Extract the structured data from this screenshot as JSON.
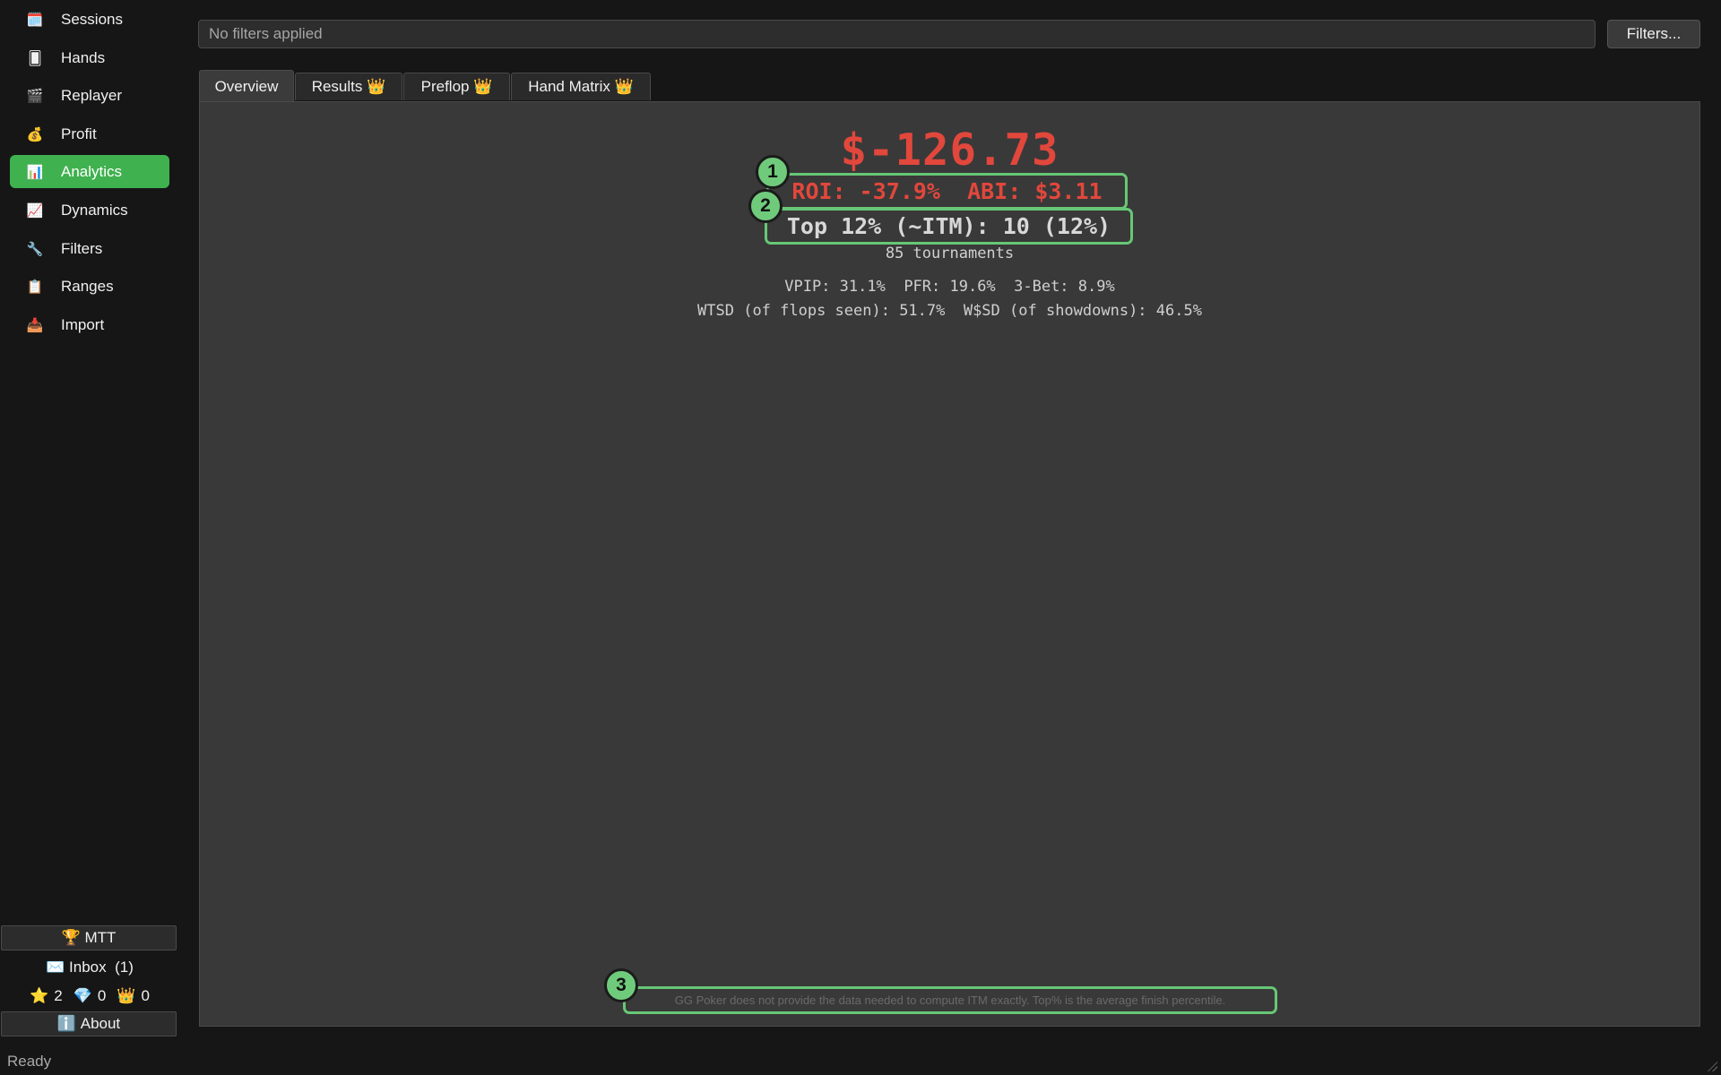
{
  "sidebar": {
    "items": [
      {
        "icon": "calendar-icon",
        "glyph": "🗓️",
        "label": "Sessions",
        "active": false
      },
      {
        "icon": "playing-card-icon",
        "glyph": "🂠",
        "label": "Hands",
        "active": false
      },
      {
        "icon": "clapperboard-icon",
        "glyph": "🎬",
        "label": "Replayer",
        "active": false
      },
      {
        "icon": "money-bag-icon",
        "glyph": "💰",
        "label": "Profit",
        "active": false
      },
      {
        "icon": "bar-chart-icon",
        "glyph": "📊",
        "label": "Analytics",
        "active": true
      },
      {
        "icon": "line-chart-icon",
        "glyph": "📈",
        "label": "Dynamics",
        "active": false
      },
      {
        "icon": "wrench-icon",
        "glyph": "🔧",
        "label": "Filters",
        "active": false
      },
      {
        "icon": "clipboard-icon",
        "glyph": "📋",
        "label": "Ranges",
        "active": false
      },
      {
        "icon": "inbox-tray-icon",
        "glyph": "📥",
        "label": "Import",
        "active": false
      }
    ],
    "mode_button": {
      "icon": "trophy-icon",
      "glyph": "🏆",
      "label": "MTT"
    },
    "inbox": {
      "icon": "envelope-icon",
      "glyph": "✉️",
      "label": "Inbox",
      "count": "(1)"
    },
    "badges": [
      {
        "icon": "star-icon",
        "glyph": "⭐",
        "value": "2"
      },
      {
        "icon": "gem-icon",
        "glyph": "💎",
        "value": "0"
      },
      {
        "icon": "crown-icon",
        "glyph": "👑",
        "value": "0"
      }
    ],
    "about_button": {
      "icon": "info-icon",
      "glyph": "ℹ️",
      "label": "About"
    }
  },
  "filter_bar": {
    "text": "No filters applied",
    "button_label": "Filters..."
  },
  "tabs": [
    {
      "label": "Overview",
      "crown": ""
    },
    {
      "label": "Results",
      "crown": "👑"
    },
    {
      "label": "Preflop",
      "crown": "👑"
    },
    {
      "label": "Hand Matrix",
      "crown": "👑"
    }
  ],
  "overview": {
    "profit": "$-126.73",
    "roi_abi": "ROI: -37.9%  ABI: $3.11",
    "top_itm": "Top 12% (~ITM): 10 (12%)",
    "tournaments": "85 tournaments",
    "stats_line1": "VPIP: 31.1%  PFR: 19.6%  3-Bet: 8.9%",
    "stats_line2": "WTSD (of flops seen): 51.7%  W$SD (of showdowns): 46.5%",
    "footnote": "GG Poker does not provide the data needed to compute ITM exactly. Top% is the average finish percentile."
  },
  "markers": [
    "1",
    "2",
    "3"
  ],
  "status": "Ready",
  "colors": {
    "accent": "#3fb14f",
    "negative": "#e2473c",
    "highlight": "#67c776"
  }
}
